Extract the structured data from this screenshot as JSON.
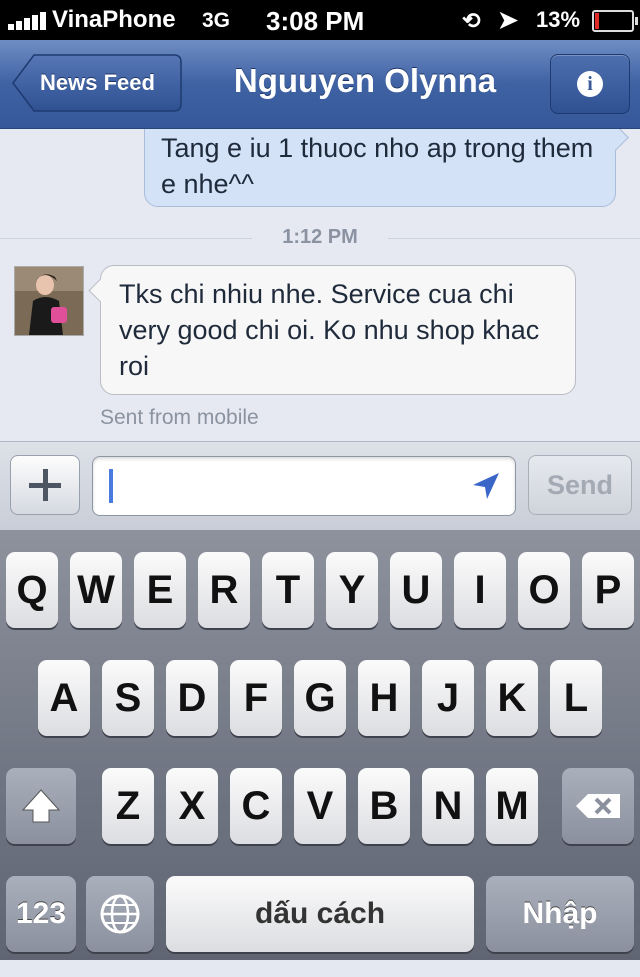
{
  "status_bar": {
    "carrier": "VinaPhone",
    "network": "3G",
    "time": "3:08 PM",
    "battery_percent": "13%",
    "battery_level": 0.13,
    "battery_color": "#e02b2b"
  },
  "nav": {
    "back_label": "News Feed",
    "title": "Nguuyen Olynna",
    "info_icon": "info-icon"
  },
  "messages": {
    "outgoing": {
      "text": "Tang e iu 1 thuoc nho ap trong them e nhe^^"
    },
    "timestamp": "1:12 PM",
    "incoming": {
      "text": "Tks chi nhiu nhe. Service cua chi very good chi oi. Ko nhu shop khac roi",
      "meta": "Sent from mobile"
    }
  },
  "composer": {
    "add_icon": "plus-icon",
    "input_value": "",
    "location_icon": "location-arrow-icon",
    "send_label": "Send"
  },
  "keyboard": {
    "row1": [
      "Q",
      "W",
      "E",
      "R",
      "T",
      "Y",
      "U",
      "I",
      "O",
      "P"
    ],
    "row2": [
      "A",
      "S",
      "D",
      "F",
      "G",
      "H",
      "J",
      "K",
      "L"
    ],
    "row3": [
      "Z",
      "X",
      "C",
      "V",
      "B",
      "N",
      "M"
    ],
    "numbers_label": "123",
    "space_label": "dấu cách",
    "return_label": "Nhập",
    "shift_icon": "shift-icon",
    "delete_icon": "backspace-icon",
    "globe_icon": "globe-icon"
  },
  "colors": {
    "nav_blue": "#3f62a3",
    "outgoing_bubble": "#d3e2f7",
    "incoming_bubble": "#f7f7f7",
    "caret": "#4a7ae0"
  }
}
